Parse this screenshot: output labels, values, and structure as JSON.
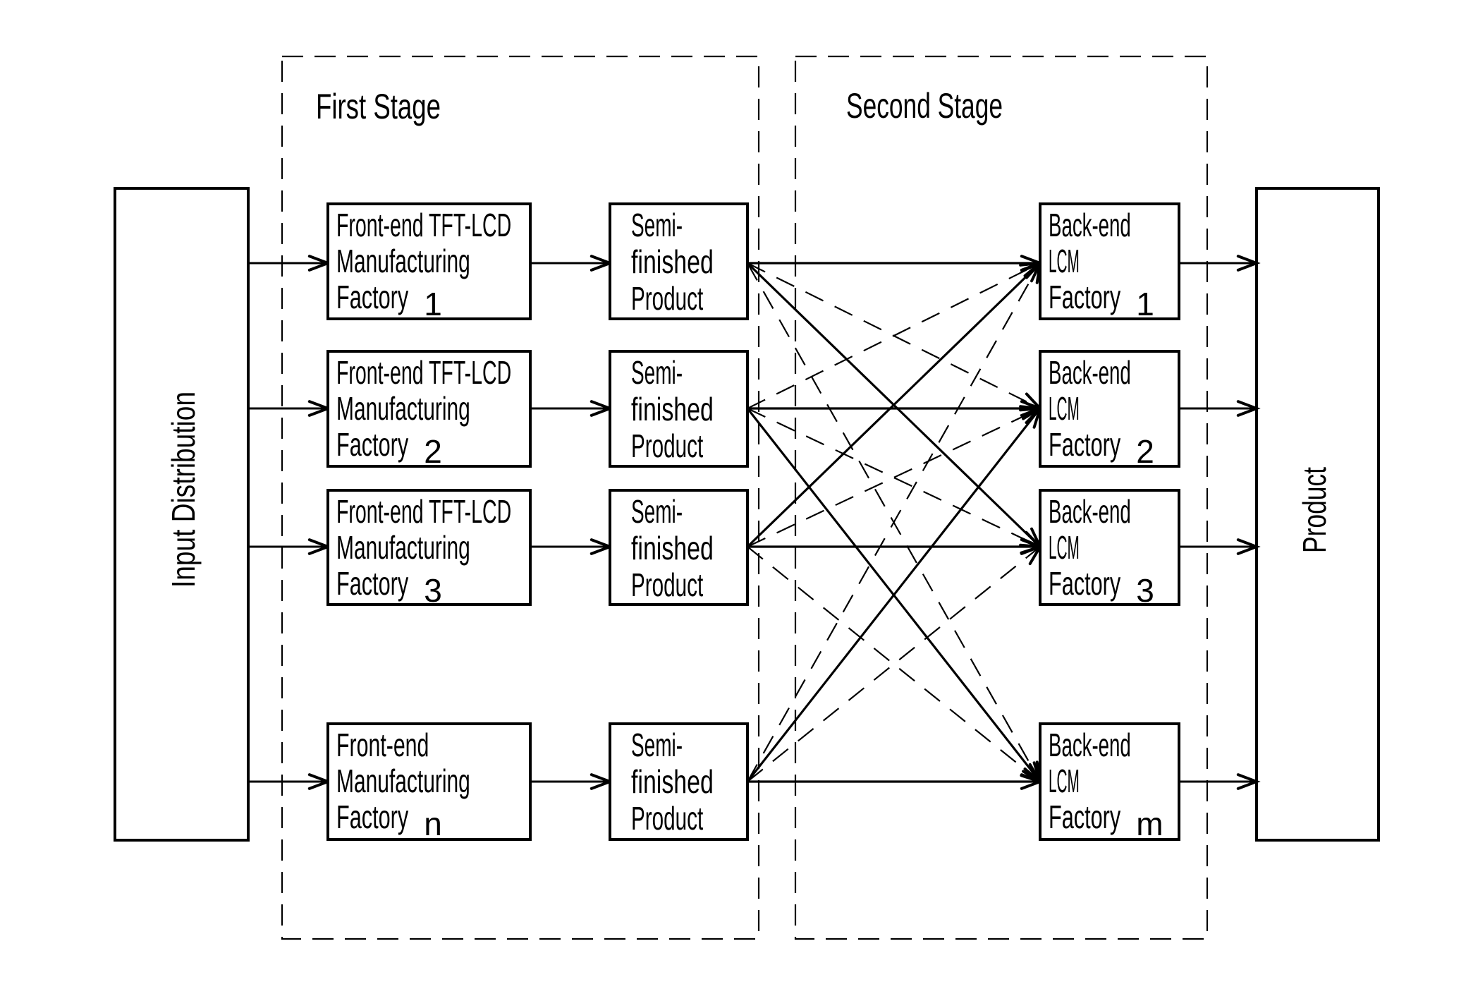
{
  "diagram": {
    "input_node": {
      "label": "Input Distribution"
    },
    "output_node": {
      "label": "Product"
    },
    "stages": [
      {
        "id": "first",
        "label": "First Stage"
      },
      {
        "id": "second",
        "label": "Second Stage"
      }
    ],
    "front_end_factories": [
      {
        "lines": [
          "Front-end TFT-LCD",
          "Manufacturing",
          "Factory"
        ],
        "index": "1"
      },
      {
        "lines": [
          "Front-end TFT-LCD",
          "Manufacturing",
          "Factory"
        ],
        "index": "2"
      },
      {
        "lines": [
          "Front-end TFT-LCD",
          "Manufacturing",
          "Factory"
        ],
        "index": "3"
      },
      {
        "lines": [
          "Front-end",
          "Manufacturing",
          "Factory"
        ],
        "index": "n"
      }
    ],
    "semi_finished": [
      {
        "lines": [
          "Semi-",
          "finished",
          "Product"
        ]
      },
      {
        "lines": [
          "Semi-",
          "finished",
          "Product"
        ]
      },
      {
        "lines": [
          "Semi-",
          "finished",
          "Product"
        ]
      },
      {
        "lines": [
          "Semi-",
          "finished",
          "Product"
        ]
      }
    ],
    "back_end_factories": [
      {
        "lines": [
          "Back-end",
          "LCM",
          "Factory"
        ],
        "index": "1"
      },
      {
        "lines": [
          "Back-end",
          "LCM",
          "Factory"
        ],
        "index": "2"
      },
      {
        "lines": [
          "Back-end",
          "LCM",
          "Factory"
        ],
        "index": "3"
      },
      {
        "lines": [
          "Back-end",
          "LCM",
          "Factory"
        ],
        "index": "m"
      }
    ],
    "cross_links": [
      {
        "from": 0,
        "to": 0,
        "style": "solid"
      },
      {
        "from": 0,
        "to": 1,
        "style": "dashed"
      },
      {
        "from": 0,
        "to": 2,
        "style": "solid"
      },
      {
        "from": 0,
        "to": 3,
        "style": "dashed"
      },
      {
        "from": 1,
        "to": 0,
        "style": "dashed"
      },
      {
        "from": 1,
        "to": 1,
        "style": "solid"
      },
      {
        "from": 1,
        "to": 2,
        "style": "dashed"
      },
      {
        "from": 1,
        "to": 3,
        "style": "solid"
      },
      {
        "from": 2,
        "to": 0,
        "style": "solid"
      },
      {
        "from": 2,
        "to": 1,
        "style": "dashed"
      },
      {
        "from": 2,
        "to": 2,
        "style": "solid"
      },
      {
        "from": 2,
        "to": 3,
        "style": "dashed"
      },
      {
        "from": 3,
        "to": 0,
        "style": "dashed"
      },
      {
        "from": 3,
        "to": 1,
        "style": "solid"
      },
      {
        "from": 3,
        "to": 2,
        "style": "dashed"
      },
      {
        "from": 3,
        "to": 3,
        "style": "solid"
      }
    ]
  }
}
